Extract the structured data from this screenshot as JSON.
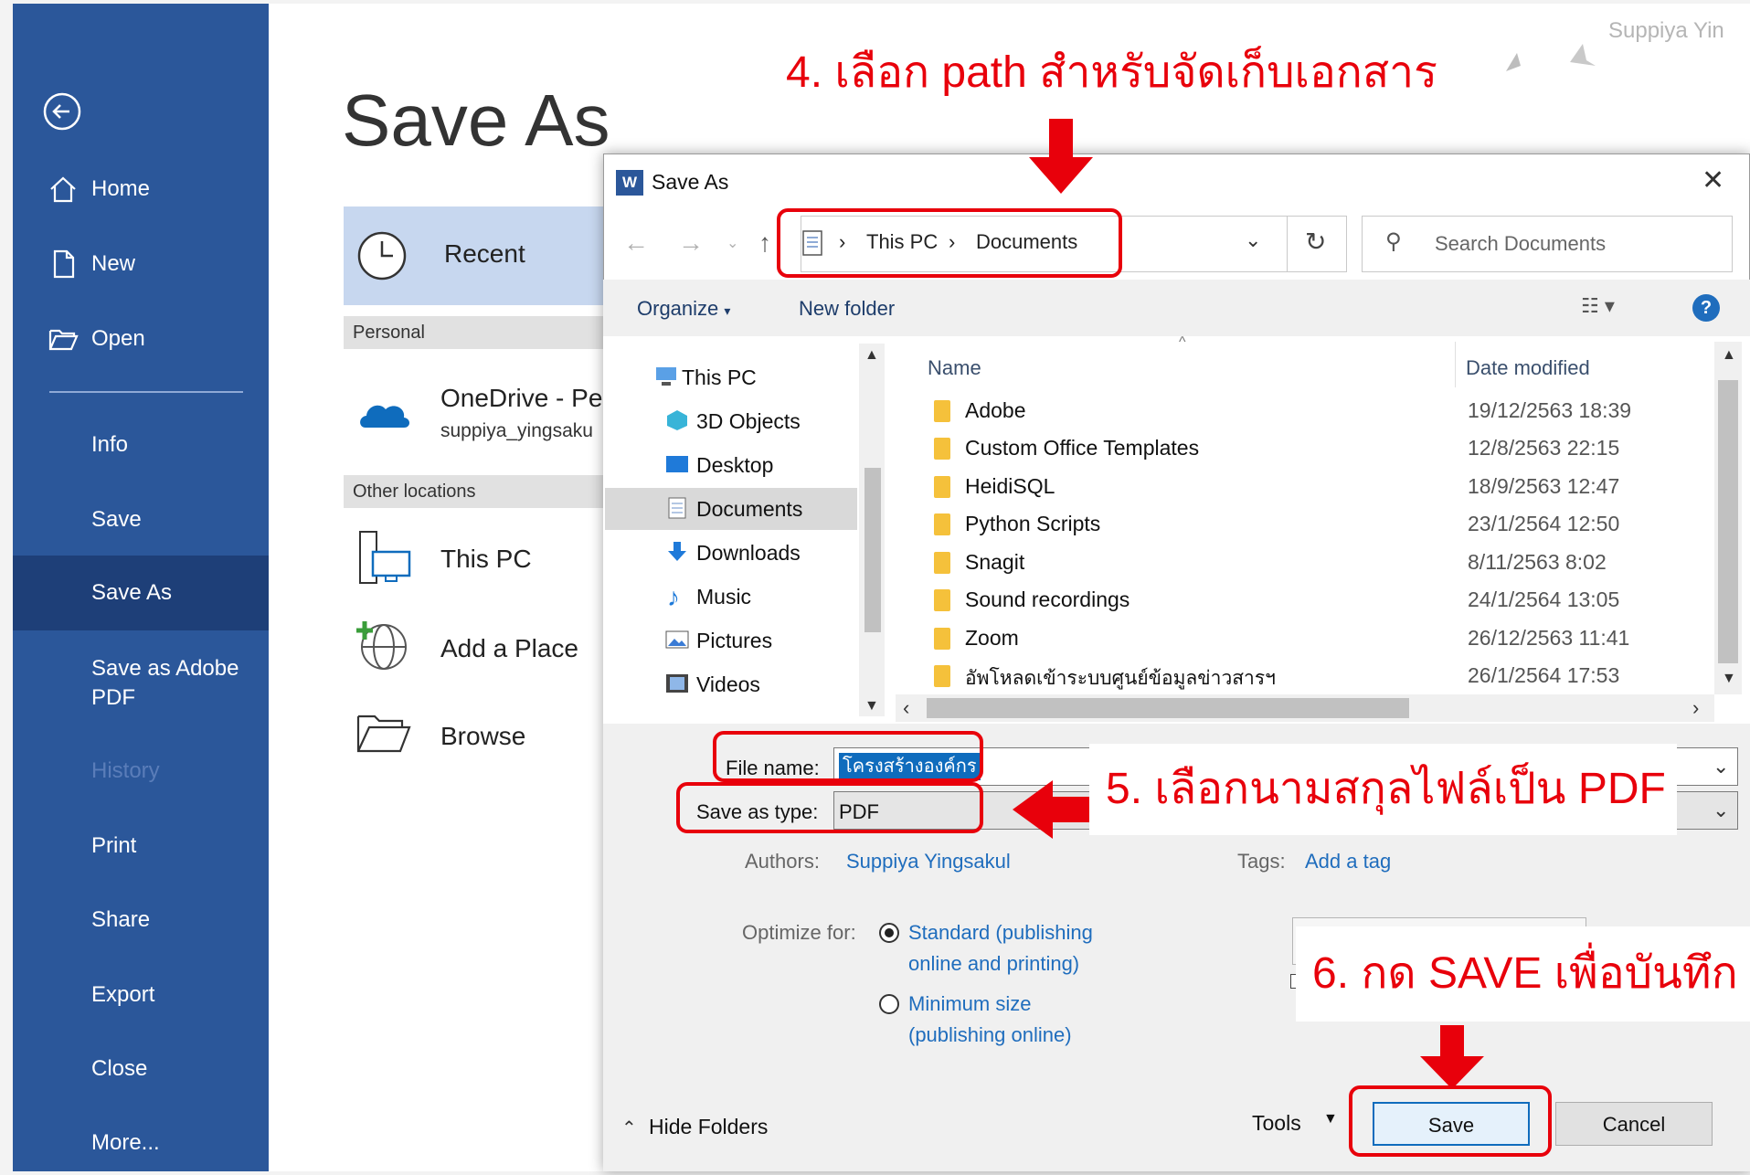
{
  "rail": {
    "items": [
      {
        "label": "Home"
      },
      {
        "label": "New"
      },
      {
        "label": "Open"
      },
      {
        "label": "Info"
      },
      {
        "label": "Save"
      },
      {
        "label": "Save As"
      },
      {
        "label": "Save as Adobe PDF"
      },
      {
        "label": "History"
      },
      {
        "label": "Print"
      },
      {
        "label": "Share"
      },
      {
        "label": "Export"
      },
      {
        "label": "Close"
      },
      {
        "label": "More..."
      }
    ]
  },
  "backstage": {
    "title": "Save As",
    "recent": "Recent",
    "personal": "Personal",
    "onedrive_title": "OneDrive - Pe",
    "onedrive_sub": "suppiya_yingsaku",
    "other_locations": "Other locations",
    "this_pc": "This PC",
    "add_place": "Add a Place",
    "browse": "Browse"
  },
  "watermark": "Suppiya Yin",
  "dialog": {
    "title": "Save As",
    "breadcrumb": [
      "This PC",
      "Documents"
    ],
    "search_placeholder": "Search Documents",
    "organize": "Organize",
    "new_folder": "New folder",
    "tree": [
      {
        "label": "This PC"
      },
      {
        "label": "3D Objects"
      },
      {
        "label": "Desktop"
      },
      {
        "label": "Documents"
      },
      {
        "label": "Downloads"
      },
      {
        "label": "Music"
      },
      {
        "label": "Pictures"
      },
      {
        "label": "Videos"
      }
    ],
    "columns": {
      "name": "Name",
      "date": "Date modified"
    },
    "files": [
      {
        "name": "Adobe",
        "date": "19/12/2563 18:39"
      },
      {
        "name": "Custom Office Templates",
        "date": "12/8/2563 22:15"
      },
      {
        "name": "HeidiSQL",
        "date": "18/9/2563 12:47"
      },
      {
        "name": "Python Scripts",
        "date": "23/1/2564 12:50"
      },
      {
        "name": "Snagit",
        "date": "8/11/2563 8:02"
      },
      {
        "name": "Sound recordings",
        "date": "24/1/2564 13:05"
      },
      {
        "name": "Zoom",
        "date": "26/12/2563 11:41"
      },
      {
        "name": "อัพโหลดเข้าระบบศูนย์ข้อมูลข่าวสารฯ",
        "date": "26/1/2564 17:53"
      }
    ],
    "file_name_label": "File name:",
    "file_name_value": "โครงสร้างองค์กร",
    "save_type_label": "Save as type:",
    "save_type_value": "PDF",
    "authors_label": "Authors:",
    "authors_value": "Suppiya Yingsakul",
    "tags_label": "Tags:",
    "tags_value": "Add a tag",
    "optimize_label": "Optimize for:",
    "opt_standard_1": "Standard (publishing",
    "opt_standard_2": "online and printing)",
    "opt_minimum_1": "Minimum size",
    "opt_minimum_2": "(publishing online)",
    "hide_folders": "Hide Folders",
    "tools": "Tools",
    "save_button": "Save",
    "cancel_button": "Cancel"
  },
  "annotations": {
    "step4": "4. เลือก path สำหรับจัดเก็บเอกสาร",
    "step5": "5. เลือกนามสกุลไฟล์เป็น PDF",
    "step6": "6. กด SAVE เพื่อบันทึก"
  },
  "colors": {
    "rail": "#2b579a",
    "rail_selected": "#1e3f78",
    "annotation": "#e8000b",
    "link": "#1f6dbd"
  }
}
